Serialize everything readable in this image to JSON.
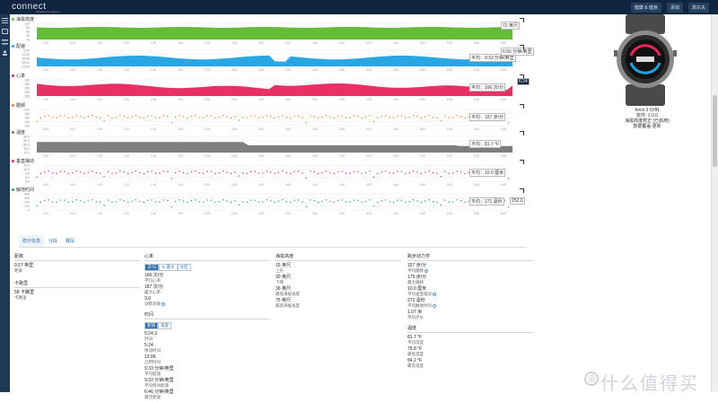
{
  "header": {
    "logo": "connect",
    "logo_sub": "Powered by Garmin",
    "buttons": [
      {
        "label": "健康 & 健身"
      },
      {
        "label": "添加"
      },
      {
        "label": "高尔夫"
      }
    ]
  },
  "charts": [
    {
      "title": "海拔高度",
      "color": "#5cb82e",
      "value": "72 英尺",
      "y_ticks": [
        "100",
        "80",
        "60",
        "40",
        "20"
      ]
    },
    {
      "title": "配速",
      "color": "#1ea2e0",
      "value": "6:56 分钟/英里",
      "avg": "平均：9:33 分钟/英里",
      "y_ticks": [
        "0:00",
        "12:00",
        "16:00",
        "20:00",
        "24:00"
      ]
    },
    {
      "title": "心率",
      "color": "#e8255d",
      "value": "6:24",
      "avg": "平均：166 次/分",
      "y_ticks": [
        "195",
        "180",
        "165",
        "150",
        "135"
      ]
    },
    {
      "title": "踏频",
      "color": "#ef7a1a",
      "value": "",
      "avg": "平均：157 步/分",
      "y_ticks": [
        "200",
        "180",
        "160",
        "140",
        "120"
      ]
    },
    {
      "title": "温度",
      "color": "#777777",
      "value": "",
      "avg": "平均：81.7 °F",
      "y_ticks": [
        "90.0",
        "85.0",
        "80.0",
        "75.0",
        "70.0"
      ]
    },
    {
      "title": "垂直摆动",
      "color": "#d62a8a",
      "value": "",
      "avg": "平均：10.0 厘米",
      "y_ticks": [
        "15.0",
        "12.0",
        "9.0",
        "6.0",
        "3.0"
      ]
    },
    {
      "title": "触地时间",
      "color": "#2a9a6a",
      "value": "",
      "avg": "平均：271 毫秒",
      "extra": "252.0",
      "y_ticks": [
        "400",
        "300",
        "200",
        "100",
        "0"
      ]
    }
  ],
  "x_ticks": [
    "0:20",
    "0:40",
    "1:00",
    "1:20",
    "1:40",
    "2:00",
    "2:20",
    "2:40",
    "3:00",
    "3:20",
    "3:40",
    "4:00",
    "4:20",
    "4:40",
    "5:00",
    "5:20",
    "5:40",
    "6:00"
  ],
  "device": {
    "name": "fenix 3 CHN",
    "firmware": "软件: 2.0.0",
    "line1": "海拔高度校正 (已启用)",
    "line2": "数据覆盖  更新"
  },
  "tabs": [
    "统计信息",
    "分段",
    "赛段"
  ],
  "stats": {
    "distance": {
      "title": "距离",
      "items": [
        {
          "val": "0.57 英里",
          "lbl": "距离"
        }
      ]
    },
    "calories": {
      "title": "卡路里",
      "items": [
        {
          "val": "58 卡路里",
          "lbl": "卡路里"
        }
      ]
    },
    "heart": {
      "title": "心率",
      "toggle": [
        "次/分",
        "% 最大",
        "分区"
      ],
      "items": [
        {
          "val": "166 次/分",
          "lbl": "平均心率"
        },
        {
          "val": "187 次/分",
          "lbl": "最大心率"
        },
        {
          "val": "3.0",
          "lbl": "训练效果"
        }
      ]
    },
    "time": {
      "title": "时间",
      "toggle": [
        "配速",
        "速度"
      ],
      "items": [
        {
          "val": "5:24.3",
          "lbl": "时间"
        },
        {
          "val": "5:24",
          "lbl": "移动时间"
        },
        {
          "val": "13:06",
          "lbl": "已用时间"
        },
        {
          "val": "9:33 分钟/英里",
          "lbl": "平均配速"
        },
        {
          "val": "9:33 分钟/英里",
          "lbl": "平均移动配速"
        },
        {
          "val": "6:46 分钟/英里",
          "lbl": "最佳配速"
        }
      ]
    },
    "elevation": {
      "title": "海拔高度",
      "items": [
        {
          "val": "15 英尺",
          "lbl": "上升"
        },
        {
          "val": "30 英尺",
          "lbl": "下降"
        },
        {
          "val": "36 英尺",
          "lbl": "最低海拔高度"
        },
        {
          "val": "75 英尺",
          "lbl": "最高海拔高度"
        }
      ]
    },
    "dynamics": {
      "title": "跑步动力学",
      "items": [
        {
          "val": "157 步/分",
          "lbl": "平均踏频"
        },
        {
          "val": "175 步/分",
          "lbl": "最大踏频"
        },
        {
          "val": "10.0 厘米",
          "lbl": "平均垂直摆动"
        },
        {
          "val": "271 毫秒",
          "lbl": "平均触地时间"
        },
        {
          "val": "1.07 米",
          "lbl": "平均步长"
        }
      ]
    },
    "temperature": {
      "title": "温度",
      "items": [
        {
          "val": "81.7 °F",
          "lbl": "平均温度"
        },
        {
          "val": "78.8 °F",
          "lbl": "最低温度"
        },
        {
          "val": "84.2 °F",
          "lbl": "最高温度"
        }
      ]
    }
  },
  "watermark": "什么值得买",
  "watermark_badge": "值"
}
